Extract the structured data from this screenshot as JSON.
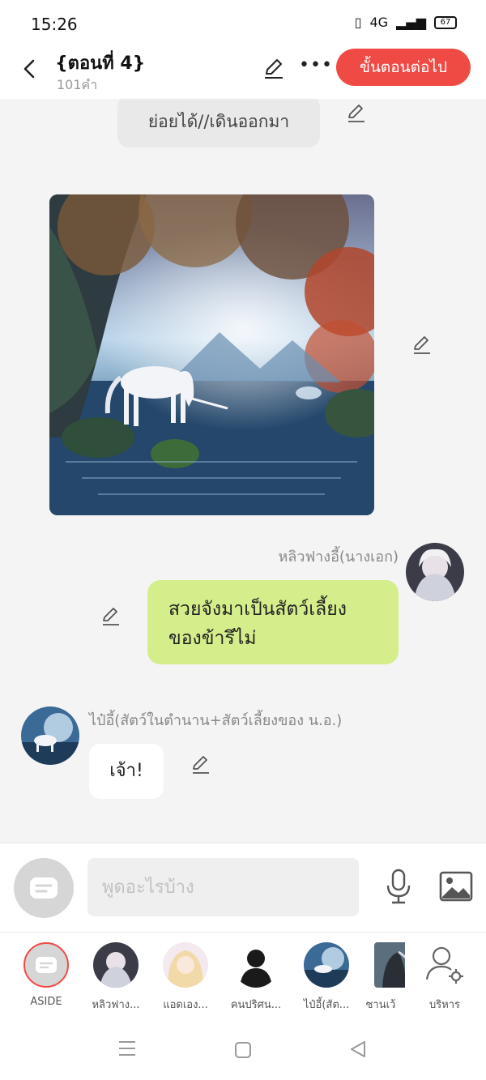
{
  "status": {
    "time": "15:26",
    "battery": "67",
    "network": "4G"
  },
  "header": {
    "title": "{ตอนที่ 4}",
    "word_count": "101คำ",
    "next_label": "ขั้นตอนต่อไป"
  },
  "chat": {
    "top_bubble": "ย่อยได้//เดินออกมา",
    "msg1": {
      "name": "หลิวฟางอี้(นางเอก)",
      "text_line1": "สวยจังมาเป็นสัตว์เลี้ยง",
      "text_line2": "ของข้ารึไม่"
    },
    "msg2": {
      "name": "ไป๋อี้(สัตว์ในตำนาน+สัตว์เลี้ยงของ น.อ.)",
      "text": "เจ้า!"
    }
  },
  "composer": {
    "placeholder": "พูดอะไรบ้าง"
  },
  "characters": [
    {
      "label": "ASIDE"
    },
    {
      "label": "หลิวฟาง..."
    },
    {
      "label": "แอดเอง..."
    },
    {
      "label": "คนปริศน..."
    },
    {
      "label": "ไป๋อี้(สัต..."
    },
    {
      "label": "ซานเว้"
    },
    {
      "label": "บริหาร"
    }
  ],
  "colors": {
    "accent": "#f04a45",
    "bubble_green": "#d4ee8c",
    "bg": "#f4f4f4"
  },
  "icons": [
    "back-icon",
    "edit-icon",
    "more-icon",
    "pen-icon",
    "mic-icon",
    "image-icon",
    "manage-icon",
    "menu-icon",
    "home-icon",
    "back-nav-icon"
  ]
}
